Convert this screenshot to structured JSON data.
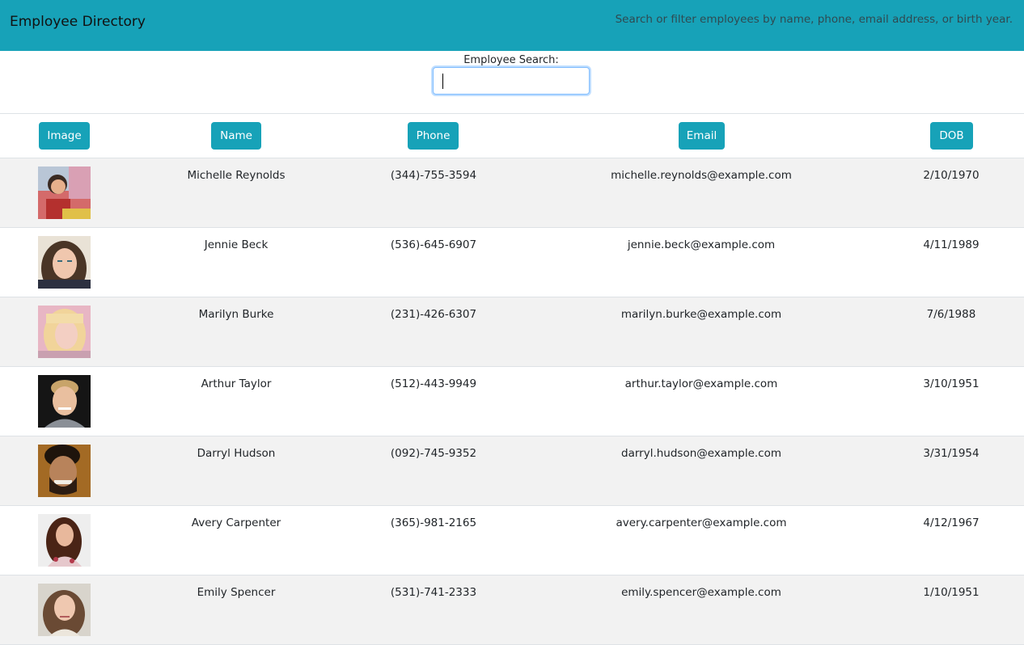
{
  "header": {
    "title": "Employee Directory",
    "subtitle": "Search or filter employees by name, phone, email address, or birth year."
  },
  "search": {
    "label": "Employee Search:",
    "value": "",
    "placeholder": ""
  },
  "columns": {
    "image": "Image",
    "name": "Name",
    "phone": "Phone",
    "email": "Email",
    "dob": "DOB"
  },
  "colors": {
    "accent": "#17a2b8",
    "stripe": "#f2f2f2"
  },
  "employees": [
    {
      "name": "Michelle Reynolds",
      "phone": "(344)-755-3594",
      "email": "michelle.reynolds@example.com",
      "dob": "2/10/1970",
      "photo": "avatar-photo"
    },
    {
      "name": "Jennie Beck",
      "phone": "(536)-645-6907",
      "email": "jennie.beck@example.com",
      "dob": "4/11/1989",
      "photo": "avatar-photo"
    },
    {
      "name": "Marilyn Burke",
      "phone": "(231)-426-6307",
      "email": "marilyn.burke@example.com",
      "dob": "7/6/1988",
      "photo": "avatar-photo"
    },
    {
      "name": "Arthur Taylor",
      "phone": "(512)-443-9949",
      "email": "arthur.taylor@example.com",
      "dob": "3/10/1951",
      "photo": "avatar-photo"
    },
    {
      "name": "Darryl Hudson",
      "phone": "(092)-745-9352",
      "email": "darryl.hudson@example.com",
      "dob": "3/31/1954",
      "photo": "avatar-photo"
    },
    {
      "name": "Avery Carpenter",
      "phone": "(365)-981-2165",
      "email": "avery.carpenter@example.com",
      "dob": "4/12/1967",
      "photo": "avatar-photo"
    },
    {
      "name": "Emily Spencer",
      "phone": "(531)-741-2333",
      "email": "emily.spencer@example.com",
      "dob": "1/10/1951",
      "photo": "avatar-photo"
    }
  ]
}
